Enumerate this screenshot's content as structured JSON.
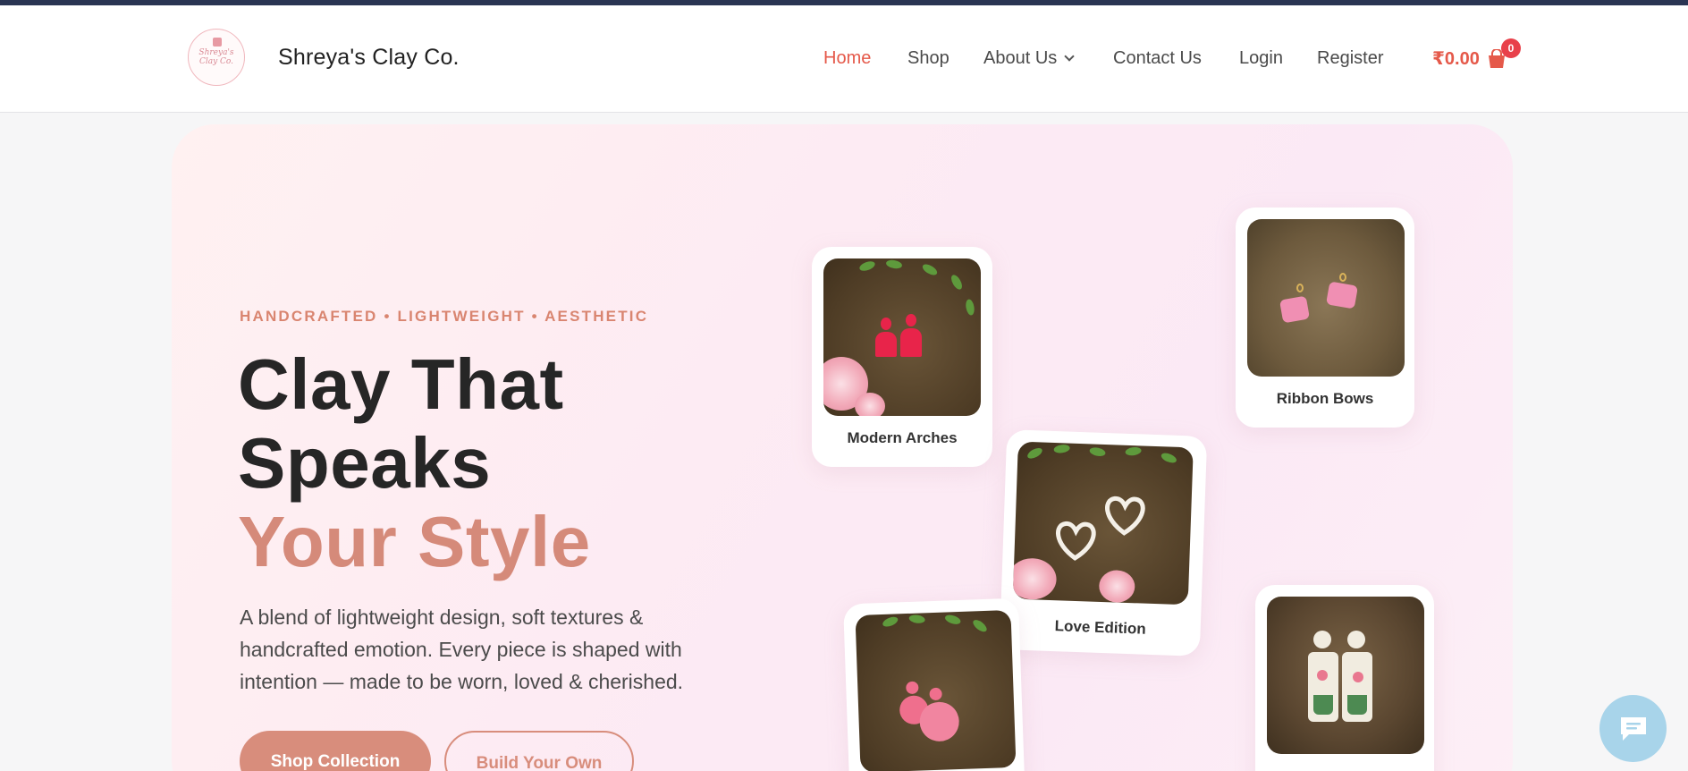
{
  "brand": {
    "name": "Shreya's Clay Co.",
    "logo_text": "Shreya's Clay Co."
  },
  "nav": {
    "items": [
      {
        "label": "Home",
        "active": true
      },
      {
        "label": "Shop"
      },
      {
        "label": "About Us"
      },
      {
        "label": "Contact Us"
      },
      {
        "label": "Login"
      },
      {
        "label": "Register"
      }
    ],
    "cart_total": "₹0.00",
    "cart_count": "0"
  },
  "hero": {
    "tagline": "HANDCRAFTED • LIGHTWEIGHT • AESTHETIC",
    "headline_line1": "Clay That",
    "headline_line2": "Speaks",
    "headline_accent": "Your Style",
    "description": "A blend of lightweight design, soft textures & handcrafted emotion. Every piece is shaped with intention — made to be worn, loved & cherished.",
    "primary_button": "Shop Collection",
    "secondary_button": "Build Your Own"
  },
  "products": [
    {
      "name": "Modern Arches"
    },
    {
      "name": "Ribbon Bows"
    },
    {
      "name": "Love Edition"
    },
    {
      "name": ""
    },
    {
      "name": ""
    }
  ],
  "colors": {
    "accent": "#e5594a",
    "brand_peach": "#d88d7c",
    "header_strip": "#2a3553",
    "chat": "#a8d4ea"
  },
  "icons": [
    "logo-emblem",
    "chevron-down-icon",
    "shopping-bag-icon",
    "chat-icon"
  ]
}
